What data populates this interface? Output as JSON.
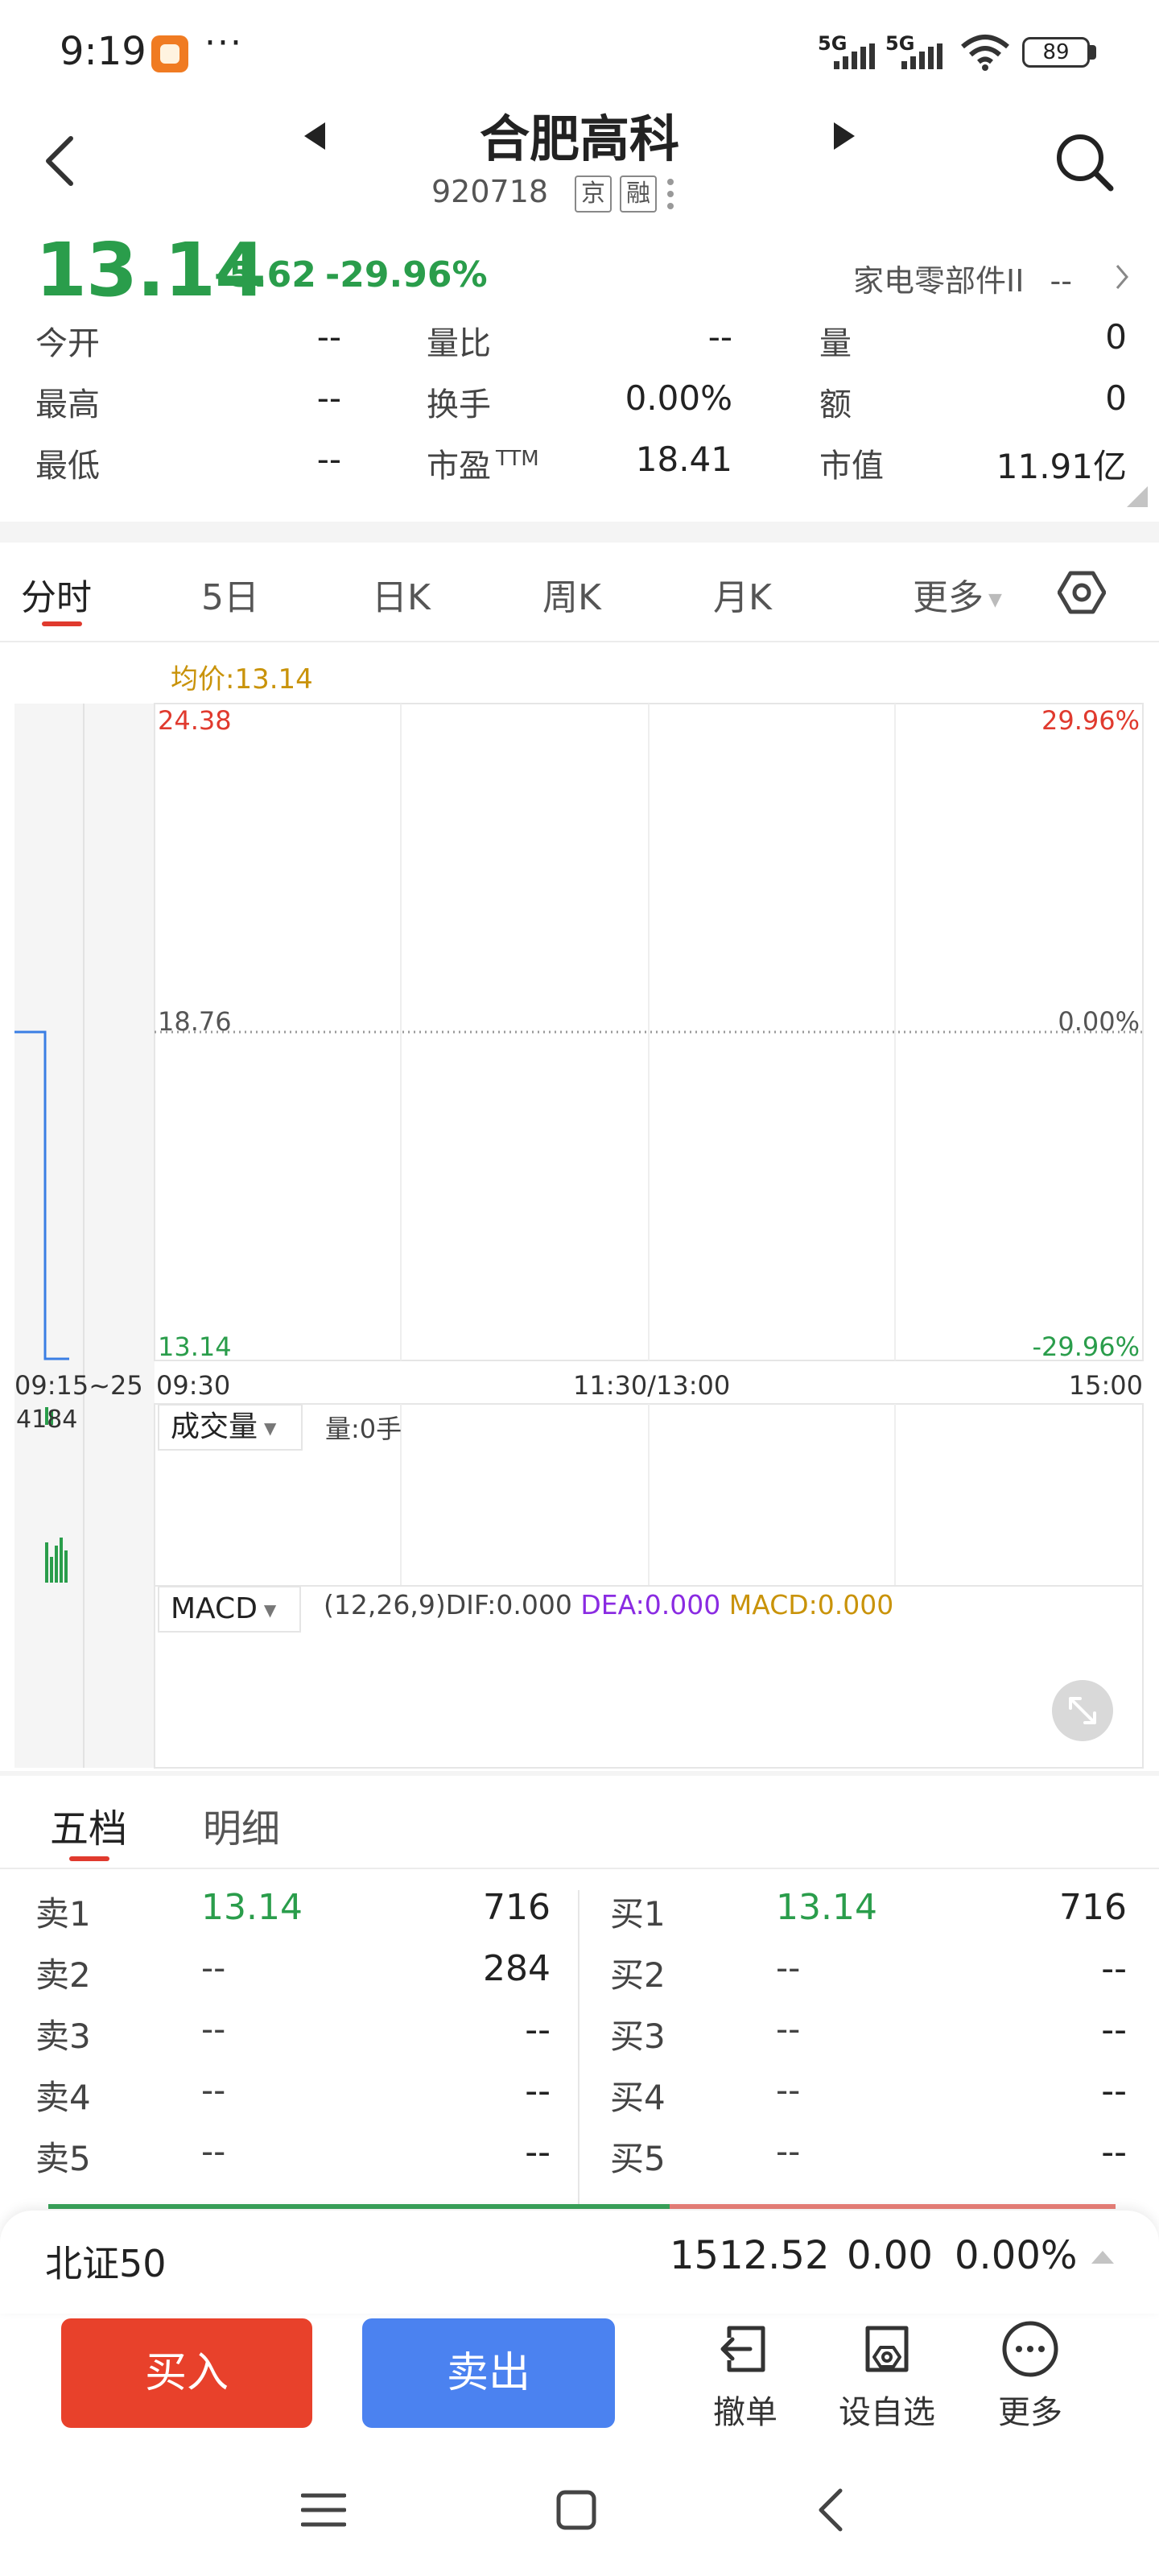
{
  "status_bar": {
    "time": "9:19",
    "more": "···",
    "signal1": "5G",
    "signal2": "5G",
    "battery": "89"
  },
  "header": {
    "name": "合肥高科",
    "code": "920718",
    "tag1": "京",
    "tag2": "融",
    "price": "13.14",
    "change": "-5.62",
    "change_pct": "-29.96%",
    "industry": "家电零部件II",
    "industry_value": "--"
  },
  "quote": {
    "open_label": "今开",
    "open_value": "--",
    "high_label": "最高",
    "high_value": "--",
    "low_label": "最低",
    "low_value": "--",
    "vol_ratio_label": "量比",
    "vol_ratio_value": "--",
    "turnover_label": "换手",
    "turnover_value": "0.00%",
    "pe_label": "市盈",
    "pe_sup": "TTM",
    "pe_value": "18.41",
    "volume_label": "量",
    "volume_value": "0",
    "amount_label": "额",
    "amount_value": "0",
    "mktcap_label": "市值",
    "mktcap_value": "11.91亿"
  },
  "tabs": [
    "分时",
    "5日",
    "日K",
    "周K",
    "月K",
    "更多"
  ],
  "chart": {
    "avg_label": "均价:13.14",
    "price_top": "24.38",
    "price_mid": "18.76",
    "price_bottom": "13.14",
    "pct_top": "29.96%",
    "pct_mid": "0.00%",
    "pct_bottom": "-29.96%",
    "time_auction": "09:15~25",
    "time_open": "09:30",
    "time_mid": "11:30/13:00",
    "time_close": "15:00",
    "volume_max": "4184",
    "volume_selector": "成交量",
    "volume_info": "量:0手",
    "macd_selector": "MACD",
    "macd_params": "(12,26,9)",
    "dif": "DIF:0.000",
    "dea": "DEA:0.000",
    "macd": "MACD:0.000"
  },
  "orderbook": {
    "tabs": [
      "五档",
      "明细"
    ],
    "asks": [
      {
        "label": "卖1",
        "price": "13.14",
        "vol": "716"
      },
      {
        "label": "卖2",
        "price": "--",
        "vol": "284"
      },
      {
        "label": "卖3",
        "price": "--",
        "vol": "--"
      },
      {
        "label": "卖4",
        "price": "--",
        "vol": "--"
      },
      {
        "label": "卖5",
        "price": "--",
        "vol": "--"
      }
    ],
    "bids": [
      {
        "label": "买1",
        "price": "13.14",
        "vol": "716"
      },
      {
        "label": "买2",
        "price": "--",
        "vol": "--"
      },
      {
        "label": "买3",
        "price": "--",
        "vol": "--"
      },
      {
        "label": "买4",
        "price": "--",
        "vol": "--"
      },
      {
        "label": "买5",
        "price": "--",
        "vol": "--"
      }
    ]
  },
  "index": {
    "name": "北证50",
    "value": "1512.52",
    "change": "0.00",
    "pct": "0.00%"
  },
  "actions": {
    "buy": "买入",
    "sell": "卖出",
    "cancel": "撤单",
    "watchlist": "设自选",
    "more": "更多"
  },
  "colors": {
    "up": "#e03a2e",
    "down": "#2a9d4b",
    "buy": "#e8412b",
    "sell": "#4b82f0",
    "avg": "#c9930a"
  }
}
